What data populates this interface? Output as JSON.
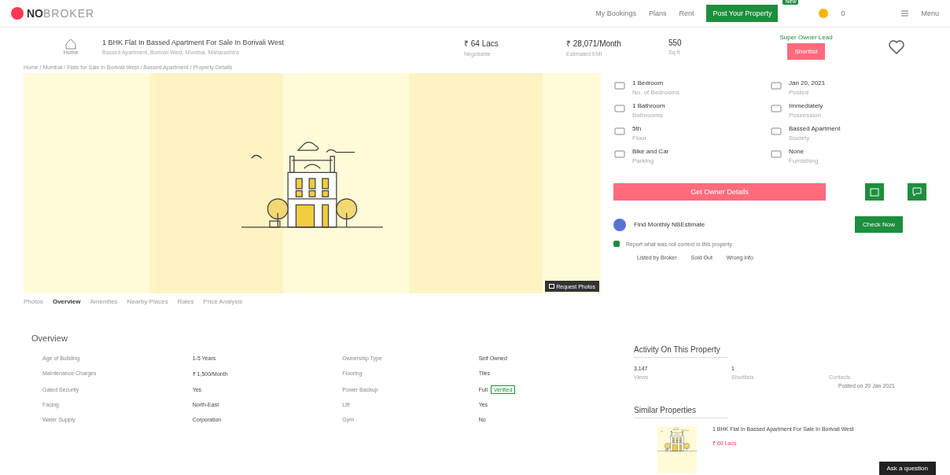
{
  "header": {
    "logo_bold": "NO",
    "logo_light": "BROKER",
    "links": [
      "My Bookings",
      "Plans",
      "Rent"
    ],
    "post_button": "Post Your Property",
    "post_badge": "New",
    "coins": "0",
    "menu": "Menu"
  },
  "summary": {
    "home_label": "Home",
    "title": "1 BHK Flat In Bassed Apartment For Sale In Borivali West",
    "subtitle": "Bassed Apartment, Borivali West, Mumbai, Maharashtra",
    "stats": [
      {
        "value": "₹ 64 Lacs",
        "label": "Negotiable"
      },
      {
        "value": "₹ 28,071/Month",
        "label": "Estimated EMI"
      },
      {
        "value": "550",
        "label": "Sq.ft"
      }
    ],
    "owner_note": "Super Owner Lead",
    "shortlist_button": "Shortlist",
    "favorite": false
  },
  "breadcrumb": "Home / Mumbai / Flats for Sale in Borivali West / Bassed Apartment / Property Details",
  "photo": {
    "request_button": "Request Photos"
  },
  "details": [
    {
      "value": "1 Bedroom",
      "label": "No. of Bedrooms"
    },
    {
      "value": "Jan 20, 2021",
      "label": "Posted"
    },
    {
      "value": "1 Bathroom",
      "label": "Bathrooms"
    },
    {
      "value": "Immediately",
      "label": "Possession"
    },
    {
      "value": "5th",
      "label": "Floor"
    },
    {
      "value": "Bassed Apartment",
      "label": "Society"
    },
    {
      "value": "Bike and Car",
      "label": "Parking"
    },
    {
      "value": "None",
      "label": "Furnishing"
    }
  ],
  "owner_button": "Get Owner Details",
  "estimate": {
    "text": "Find Monthly NBEstimate",
    "button": "Check Now"
  },
  "report": {
    "text": "Report what was not correct in this property",
    "links": [
      "Listed by Broker",
      "Sold Out",
      "Wrong Info"
    ]
  },
  "tabs": [
    {
      "label": "Photos",
      "selected": false
    },
    {
      "label": "Overview",
      "selected": true
    },
    {
      "label": "Amenities",
      "selected": false
    },
    {
      "label": "Nearby Places",
      "selected": false
    },
    {
      "label": "Rates",
      "selected": false
    },
    {
      "label": "Price Analysis",
      "selected": false
    }
  ],
  "overview": {
    "title": "Overview",
    "rows": [
      [
        "Age of Building",
        "1-5 Years",
        "Ownership Type",
        "Self Owned"
      ],
      [
        "Maintenance Charges",
        "₹ 1,500/Month",
        "Flooring",
        "Tiles"
      ],
      [
        "Gated Security",
        "Yes",
        "Power Backup",
        "Full"
      ],
      [
        "Facing",
        "North-East",
        "Lift",
        "Yes"
      ],
      [
        "Water Supply",
        "Corporation",
        "Gym",
        "No"
      ]
    ],
    "verified_tag": "Verified"
  },
  "activity": {
    "title": "Activity On This Property",
    "items": [
      {
        "value": "3,147",
        "label": "Views"
      },
      {
        "value": "1",
        "label": "Shortlists"
      },
      {
        "value": "",
        "label": "Contacts"
      }
    ],
    "note": "Posted on 20 Jan 2021"
  },
  "similar": {
    "title": "Similar Properties",
    "item_title": "1 BHK Flat In Bassed Apartment For Sale In Borivali West",
    "price": "₹ 60 Lacs"
  },
  "chat_button": "Ask a question"
}
